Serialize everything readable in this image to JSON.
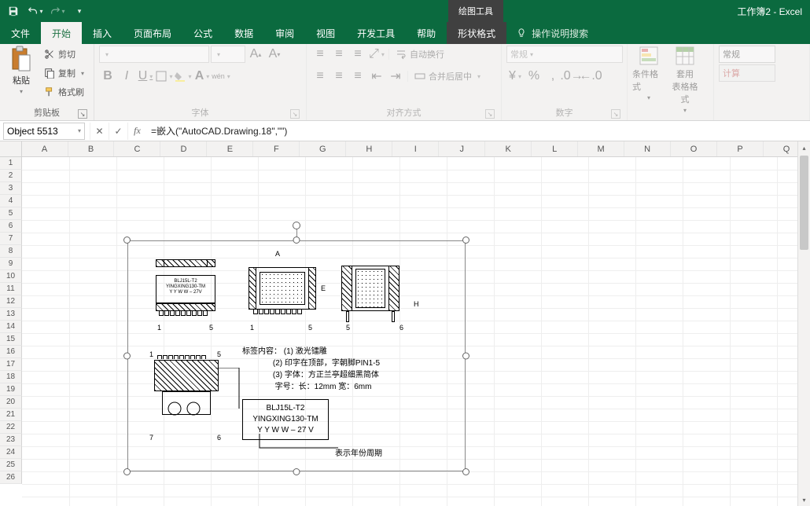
{
  "titlebar": {
    "context_tool": "绘图工具",
    "doc_title": "工作簿2  -  Excel"
  },
  "tabs": {
    "file": "文件",
    "home": "开始",
    "insert": "插入",
    "layout": "页面布局",
    "formulas": "公式",
    "data": "数据",
    "review": "审阅",
    "view": "视图",
    "dev": "开发工具",
    "help": "帮助",
    "shape_format": "形状格式",
    "tell_me": "操作说明搜索"
  },
  "ribbon": {
    "clipboard": {
      "paste": "粘贴",
      "cut": "剪切",
      "copy": "复制",
      "painter": "格式刷",
      "group": "剪贴板"
    },
    "font": {
      "bold": "B",
      "italic": "I",
      "underline": "U",
      "group": "字体"
    },
    "align": {
      "wrap": "自动换行",
      "merge": "合并后居中",
      "group": "对齐方式"
    },
    "number": {
      "format": "常规",
      "group": "数字"
    },
    "styles": {
      "cond": "条件格式",
      "table": "套用\n表格格式",
      "cell": "常规",
      "calc": "计算"
    }
  },
  "namebox": "Object 5513",
  "formula": "=嵌入(\"AutoCAD.Drawing.18\",\"\")",
  "columns": [
    "A",
    "B",
    "C",
    "D",
    "E",
    "F",
    "G",
    "H",
    "I",
    "J",
    "K",
    "L",
    "M",
    "N",
    "O",
    "P",
    "Q"
  ],
  "rows": [
    "1",
    "2",
    "3",
    "4",
    "5",
    "6",
    "7",
    "8",
    "9",
    "10",
    "11",
    "12",
    "13",
    "14",
    "15",
    "16",
    "17",
    "18",
    "19",
    "20",
    "21",
    "22",
    "23",
    "24",
    "25",
    "26"
  ],
  "drawing": {
    "box_label": {
      "l1": "BLJ15L-T2",
      "l2": "YINGXING130-TM",
      "l3": "Y Y W W – 27 V"
    },
    "annot_title": "标签内容：",
    "annot1": "(1) 激光镭雕",
    "annot2": "(2) 印字在顶部，字朝脚PIN1-5",
    "annot3": "(3) 字体：方正兰亭超细黑简体",
    "annot4": "    字号：长：12mm 宽：6mm",
    "yearlabel": "表示年份周期",
    "pin1": "1",
    "pin5": "5",
    "pin6": "6",
    "pin7": "7",
    "chip_l1": "BLJ15L-T2",
    "chip_l2": "YINGXING130-TM",
    "chip_l3": "Y Y W W – 27V",
    "dimA": "A",
    "dimE": "E",
    "dimH": "H"
  }
}
